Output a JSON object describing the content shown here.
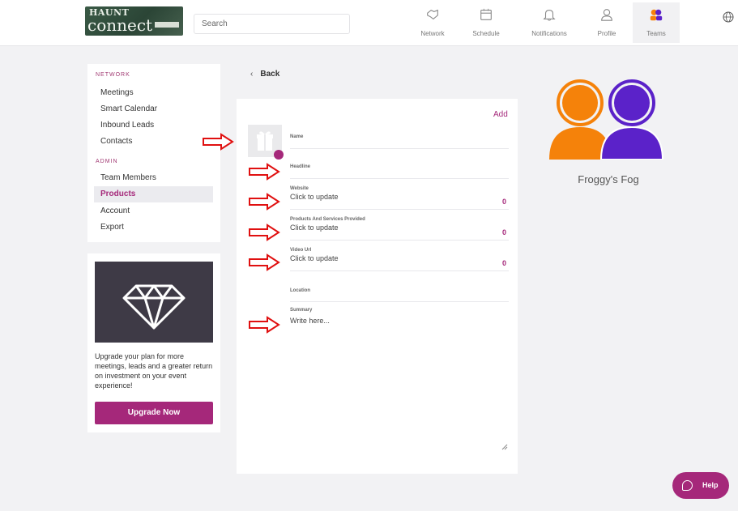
{
  "header": {
    "logo_text_top": "HAUNT",
    "logo_text_bottom": "connect",
    "search_placeholder": "Search",
    "nav": [
      {
        "label": "Network",
        "icon": "handshake-icon"
      },
      {
        "label": "Schedule",
        "icon": "calendar-icon"
      },
      {
        "label": "Notifications",
        "icon": "bell-icon"
      },
      {
        "label": "Profile",
        "icon": "person-icon"
      },
      {
        "label": "Teams",
        "icon": "team-icon",
        "active": true
      }
    ],
    "language_icon": "globe-icon"
  },
  "sidebar": {
    "network_heading": "NETWORK",
    "network_items": [
      "Meetings",
      "Smart Calendar",
      "Inbound Leads",
      "Contacts"
    ],
    "admin_heading": "ADMIN",
    "admin_items": [
      "Team Members",
      "Products",
      "Account",
      "Export"
    ],
    "active_item": "Products",
    "upgrade": {
      "icon": "diamond-icon",
      "text": "Upgrade your plan for more meetings, leads and a greater return on investment on your event experience!",
      "button": "Upgrade Now"
    }
  },
  "main": {
    "back_label": "Back",
    "add_label": "Add",
    "fields": {
      "name": {
        "label": "Name"
      },
      "headline": {
        "label": "Headline"
      },
      "website": {
        "label": "Website",
        "value": "Click to update",
        "count": "0"
      },
      "products": {
        "label": "Products And Services Provided",
        "value": "Click to update",
        "count": "0"
      },
      "video": {
        "label": "Video Url",
        "value": "Click to update",
        "count": "0"
      },
      "location": {
        "label": "Location"
      },
      "summary": {
        "label": "Summary",
        "placeholder": "Write here..."
      }
    }
  },
  "team": {
    "name": "Froggy's Fog",
    "colors": {
      "left": "#f5820a",
      "right": "#5b22c9"
    }
  },
  "help": {
    "label": "Help"
  },
  "colors": {
    "accent": "#a5287a",
    "annotation": "#e01010"
  }
}
